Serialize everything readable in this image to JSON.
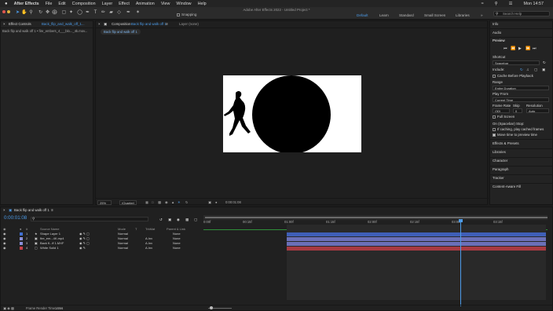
{
  "menubar": {
    "apple": "",
    "app_name": "After Effects",
    "items": [
      "File",
      "Edit",
      "Composition",
      "Layer",
      "Effect",
      "Animation",
      "View",
      "Window",
      "Help"
    ],
    "clock": "Mon 14:57"
  },
  "window": {
    "title": "Adobe After Effects 2022 - Untitled Project *",
    "snapping": "Snapping",
    "workspaces": [
      "Default",
      "Learn",
      "Standard",
      "Small Screen",
      "Libraries"
    ],
    "search": "Search Help"
  },
  "effect_controls": {
    "tab": "Effect Controls",
    "tab_target": "Back_flip_and_walk_off_1...",
    "breadcrumb": "Back flip and walk off 1 • fire_embers_4___blo..._4k.mov..."
  },
  "composition": {
    "tab_label": "Composition",
    "tab_target": "Back flip and walk off 1",
    "layer_tab": "Layer (none)",
    "crumb": "Back flip and walk off 1",
    "zoom": "25%",
    "resolution": "(Quarter)",
    "timecode": "0:00:01:08"
  },
  "right_panel": {
    "info": "Info",
    "audio": "Audio",
    "preview": "Preview",
    "shortcut_label": "Shortcut",
    "shortcut_value": "Spacebar",
    "include_label": "Include:",
    "cache_label": "Cache Before Playback",
    "range_label": "Range",
    "range_value": "Entire Duration",
    "play_from_label": "Play From",
    "play_from_value": "Current Time",
    "frame_rate_label": "Frame Rate",
    "skip_label": "Skip",
    "resolution_label": "Resolution",
    "frame_rate_value": "(30)",
    "skip_value": "0",
    "resolution_value": "Auto",
    "full_screen": "Full Screen",
    "on_stop": "On (Spacebar) Stop:",
    "if_caching": "If caching, play cached frames",
    "move_time": "Move time to preview time",
    "sections": [
      "Effects & Presets",
      "Libraries",
      "Character",
      "Paragraph",
      "Tracker",
      "Content-Aware Fill"
    ]
  },
  "timeline": {
    "tab": "Back flip and walk off 1",
    "timecode": "0:00:01:08",
    "col_source": "Source Name",
    "col_mode": "Mode",
    "col_t": "T",
    "col_trkmat": "TrkMat",
    "col_parent": "Parent & Link",
    "ticks": [
      "0:00f",
      "00:15f",
      "01:00f",
      "01:15f",
      "02:00f",
      "02:15f",
      "03:00f",
      "03:15f"
    ],
    "layers": [
      {
        "num": "1",
        "name": "Shape Layer 1",
        "mode": "Normal",
        "trkmat": "",
        "parent": "None",
        "color": "#3f6fd3"
      },
      {
        "num": "2",
        "name": "fire_em...4K.mp4",
        "mode": "Normal",
        "trkmat": "A.Inv",
        "parent": "None",
        "color": "#8a8fd8"
      },
      {
        "num": "3",
        "name": "Back fl...ff 1.MXF",
        "mode": "Normal",
        "trkmat": "A.Inv",
        "parent": "None",
        "color": "#8a8fd8"
      },
      {
        "num": "4",
        "name": "White Solid 1",
        "mode": "Normal",
        "trkmat": "A.Inv",
        "parent": "None",
        "color": "#c8414a"
      }
    ],
    "footer": "Frame Render Time",
    "footer_value": "14ms"
  }
}
